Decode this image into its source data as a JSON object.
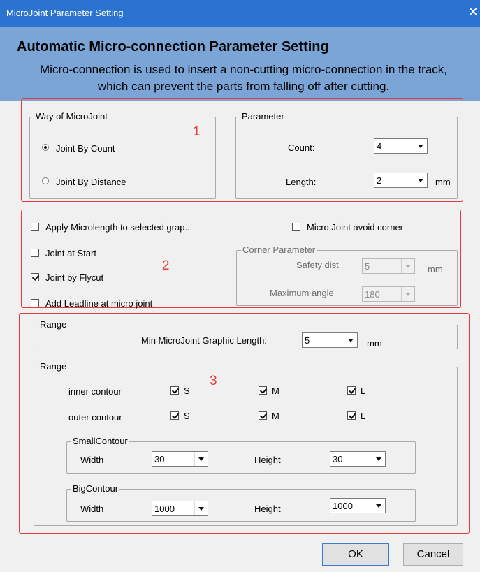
{
  "window": {
    "title": "MicroJoint Parameter Setting",
    "close_glyph": "✕"
  },
  "header": {
    "title": "Automatic Micro-connection Parameter Setting",
    "description": "Micro-connection is used to insert a non-cutting micro-connection in the track, which can prevent the parts from falling off after cutting."
  },
  "annotations": {
    "box1": "1",
    "box2": "2",
    "box3": "3",
    "color": "#e53a3a"
  },
  "way_group": {
    "legend": "Way of MicroJoint",
    "options": [
      {
        "label": "Joint By Count",
        "selected": true
      },
      {
        "label": "Joint By Distance",
        "selected": false
      }
    ]
  },
  "parameter_group": {
    "legend": "Parameter",
    "count": {
      "label": "Count:",
      "value": "4"
    },
    "length": {
      "label": "Length:",
      "value": "2",
      "unit": "mm"
    }
  },
  "options": {
    "apply_microlength": {
      "label": "Apply Microlength to selected grap...",
      "checked": false
    },
    "avoid_corner": {
      "label": "Micro Joint avoid corner",
      "checked": false
    },
    "joint_at_start": {
      "label": "Joint at Start",
      "checked": false
    },
    "joint_by_flycut": {
      "label": "Joint by Flycut",
      "checked": true
    },
    "add_leadline": {
      "label": "Add Leadline at micro joint",
      "checked": false
    }
  },
  "corner_group": {
    "legend": "Corner Parameter",
    "safety_dist": {
      "label": "Safety dist",
      "value": "5",
      "unit": "mm"
    },
    "max_angle": {
      "label": "Maximum angle",
      "value": "180"
    }
  },
  "range_top": {
    "legend": "Range",
    "min_length": {
      "label": "Min MicroJoint Graphic Length:",
      "value": "5",
      "unit": "mm"
    }
  },
  "range_main": {
    "legend": "Range",
    "rows": [
      {
        "label": "inner contour",
        "s": "S",
        "m": "M",
        "l": "L"
      },
      {
        "label": "outer contour",
        "s": "S",
        "m": "M",
        "l": "L"
      }
    ],
    "small_contour": {
      "legend": "SmallContour",
      "width_label": "Width",
      "width": "30",
      "height_label": "Height",
      "height": "30"
    },
    "big_contour": {
      "legend": "BigContour",
      "width_label": "Width",
      "width": "1000",
      "height_label": "Height",
      "height": "1000"
    }
  },
  "buttons": {
    "ok": "OK",
    "cancel": "Cancel"
  },
  "colors": {
    "titlebar": "#2b73d1",
    "header": "#7aa5d6",
    "annotation_red": "#e53a3a"
  }
}
